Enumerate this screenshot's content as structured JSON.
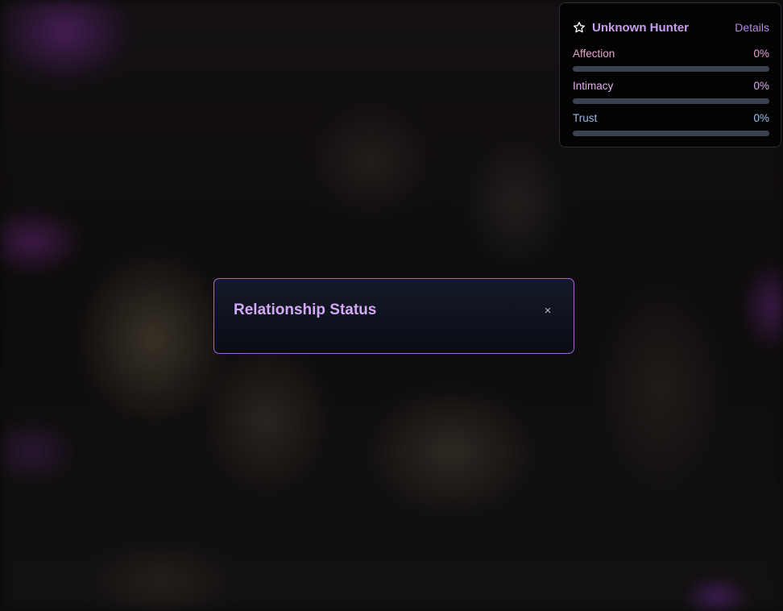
{
  "stats_panel": {
    "name": "Unknown Hunter",
    "details_label": "Details",
    "icon": "star-outline-icon",
    "stats": [
      {
        "label": "Affection",
        "value_text": "0%",
        "value": 0,
        "color": "#e8a3d0"
      },
      {
        "label": "Intimacy",
        "value_text": "0%",
        "value": 0,
        "color": "#e0b0f0"
      },
      {
        "label": "Trust",
        "value_text": "0%",
        "value": 0,
        "color": "#9fc2ec"
      }
    ]
  },
  "modal": {
    "title": "Relationship Status",
    "close_label": "×"
  },
  "colors": {
    "accent": "#a263d8",
    "title": "#d3a8f5",
    "track": "#3b4250"
  }
}
